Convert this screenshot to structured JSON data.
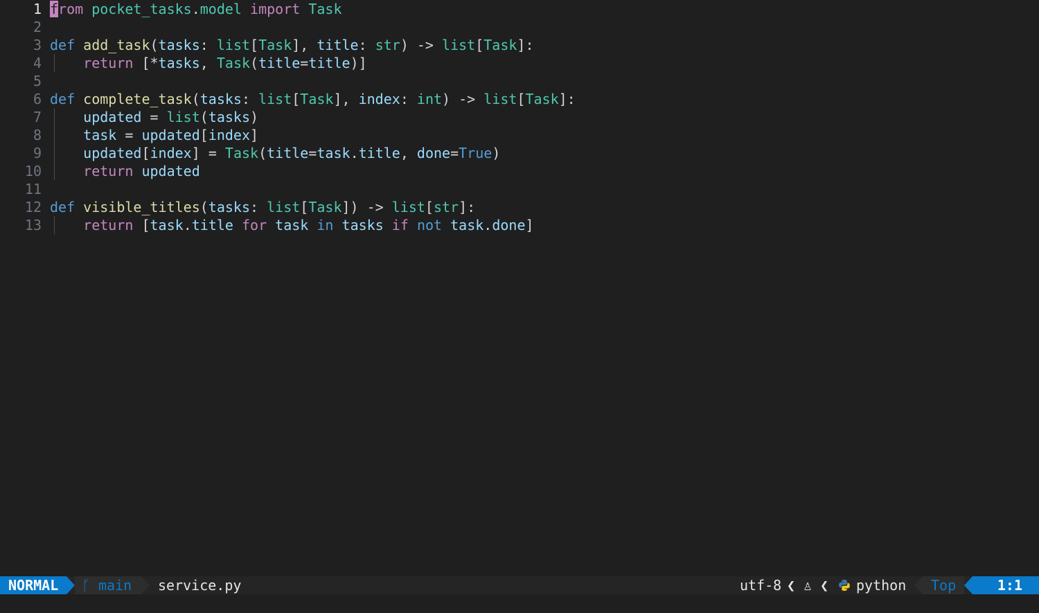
{
  "editor": {
    "lines": [
      {
        "n": "1",
        "tokens": [
          {
            "t": "f",
            "c": "cursor"
          },
          {
            "t": "rom",
            "c": "keyword"
          },
          {
            "t": " ",
            "c": "punct"
          },
          {
            "t": "pocket_tasks",
            "c": "module"
          },
          {
            "t": ".",
            "c": "punct"
          },
          {
            "t": "model",
            "c": "module"
          },
          {
            "t": " ",
            "c": "punct"
          },
          {
            "t": "import",
            "c": "keyword"
          },
          {
            "t": " ",
            "c": "punct"
          },
          {
            "t": "Task",
            "c": "type"
          }
        ]
      },
      {
        "n": "2",
        "tokens": []
      },
      {
        "n": "3",
        "tokens": [
          {
            "t": "def",
            "c": "def"
          },
          {
            "t": " ",
            "c": "punct"
          },
          {
            "t": "add_task",
            "c": "funcname"
          },
          {
            "t": "(",
            "c": "punct"
          },
          {
            "t": "tasks",
            "c": "param"
          },
          {
            "t": ": ",
            "c": "punct"
          },
          {
            "t": "list",
            "c": "type"
          },
          {
            "t": "[",
            "c": "punct"
          },
          {
            "t": "Task",
            "c": "type"
          },
          {
            "t": "], ",
            "c": "punct"
          },
          {
            "t": "title",
            "c": "param"
          },
          {
            "t": ": ",
            "c": "punct"
          },
          {
            "t": "str",
            "c": "type"
          },
          {
            "t": ") -> ",
            "c": "punct"
          },
          {
            "t": "list",
            "c": "type"
          },
          {
            "t": "[",
            "c": "punct"
          },
          {
            "t": "Task",
            "c": "type"
          },
          {
            "t": "]:",
            "c": "punct"
          }
        ]
      },
      {
        "n": "4",
        "guide": true,
        "tokens": [
          {
            "t": "    ",
            "c": "punct"
          },
          {
            "t": "return",
            "c": "keyword"
          },
          {
            "t": " [*",
            "c": "punct"
          },
          {
            "t": "tasks",
            "c": "param"
          },
          {
            "t": ", ",
            "c": "punct"
          },
          {
            "t": "Task",
            "c": "type"
          },
          {
            "t": "(",
            "c": "punct"
          },
          {
            "t": "title",
            "c": "param"
          },
          {
            "t": "=",
            "c": "punct"
          },
          {
            "t": "title",
            "c": "param"
          },
          {
            "t": ")]",
            "c": "punct"
          }
        ]
      },
      {
        "n": "5",
        "tokens": []
      },
      {
        "n": "6",
        "tokens": [
          {
            "t": "def",
            "c": "def"
          },
          {
            "t": " ",
            "c": "punct"
          },
          {
            "t": "complete_task",
            "c": "funcname"
          },
          {
            "t": "(",
            "c": "punct"
          },
          {
            "t": "tasks",
            "c": "param"
          },
          {
            "t": ": ",
            "c": "punct"
          },
          {
            "t": "list",
            "c": "type"
          },
          {
            "t": "[",
            "c": "punct"
          },
          {
            "t": "Task",
            "c": "type"
          },
          {
            "t": "], ",
            "c": "punct"
          },
          {
            "t": "index",
            "c": "param"
          },
          {
            "t": ": ",
            "c": "punct"
          },
          {
            "t": "int",
            "c": "type"
          },
          {
            "t": ") -> ",
            "c": "punct"
          },
          {
            "t": "list",
            "c": "type"
          },
          {
            "t": "[",
            "c": "punct"
          },
          {
            "t": "Task",
            "c": "type"
          },
          {
            "t": "]:",
            "c": "punct"
          }
        ]
      },
      {
        "n": "7",
        "guide": true,
        "tokens": [
          {
            "t": "    ",
            "c": "punct"
          },
          {
            "t": "updated",
            "c": "param"
          },
          {
            "t": " = ",
            "c": "punct"
          },
          {
            "t": "list",
            "c": "type"
          },
          {
            "t": "(",
            "c": "punct"
          },
          {
            "t": "tasks",
            "c": "param"
          },
          {
            "t": ")",
            "c": "punct"
          }
        ]
      },
      {
        "n": "8",
        "guide": true,
        "tokens": [
          {
            "t": "    ",
            "c": "punct"
          },
          {
            "t": "task",
            "c": "param"
          },
          {
            "t": " = ",
            "c": "punct"
          },
          {
            "t": "updated",
            "c": "param"
          },
          {
            "t": "[",
            "c": "punct"
          },
          {
            "t": "index",
            "c": "param"
          },
          {
            "t": "]",
            "c": "punct"
          }
        ]
      },
      {
        "n": "9",
        "guide": true,
        "tokens": [
          {
            "t": "    ",
            "c": "punct"
          },
          {
            "t": "updated",
            "c": "param"
          },
          {
            "t": "[",
            "c": "punct"
          },
          {
            "t": "index",
            "c": "param"
          },
          {
            "t": "] = ",
            "c": "punct"
          },
          {
            "t": "Task",
            "c": "type"
          },
          {
            "t": "(",
            "c": "punct"
          },
          {
            "t": "title",
            "c": "param"
          },
          {
            "t": "=",
            "c": "punct"
          },
          {
            "t": "task",
            "c": "param"
          },
          {
            "t": ".",
            "c": "punct"
          },
          {
            "t": "title",
            "c": "param"
          },
          {
            "t": ", ",
            "c": "punct"
          },
          {
            "t": "done",
            "c": "param"
          },
          {
            "t": "=",
            "c": "punct"
          },
          {
            "t": "True",
            "c": "const"
          },
          {
            "t": ")",
            "c": "punct"
          }
        ]
      },
      {
        "n": "10",
        "guide": true,
        "tokens": [
          {
            "t": "    ",
            "c": "punct"
          },
          {
            "t": "return",
            "c": "keyword"
          },
          {
            "t": " ",
            "c": "punct"
          },
          {
            "t": "updated",
            "c": "param"
          }
        ]
      },
      {
        "n": "11",
        "tokens": []
      },
      {
        "n": "12",
        "tokens": [
          {
            "t": "def",
            "c": "def"
          },
          {
            "t": " ",
            "c": "punct"
          },
          {
            "t": "visible_titles",
            "c": "funcname"
          },
          {
            "t": "(",
            "c": "punct"
          },
          {
            "t": "tasks",
            "c": "param"
          },
          {
            "t": ": ",
            "c": "punct"
          },
          {
            "t": "list",
            "c": "type"
          },
          {
            "t": "[",
            "c": "punct"
          },
          {
            "t": "Task",
            "c": "type"
          },
          {
            "t": "]) -> ",
            "c": "punct"
          },
          {
            "t": "list",
            "c": "type"
          },
          {
            "t": "[",
            "c": "punct"
          },
          {
            "t": "str",
            "c": "type"
          },
          {
            "t": "]:",
            "c": "punct"
          }
        ]
      },
      {
        "n": "13",
        "guide": true,
        "tokens": [
          {
            "t": "    ",
            "c": "punct"
          },
          {
            "t": "return",
            "c": "keyword"
          },
          {
            "t": " [",
            "c": "punct"
          },
          {
            "t": "task",
            "c": "param"
          },
          {
            "t": ".",
            "c": "punct"
          },
          {
            "t": "title",
            "c": "param"
          },
          {
            "t": " ",
            "c": "punct"
          },
          {
            "t": "for",
            "c": "keyword"
          },
          {
            "t": " ",
            "c": "punct"
          },
          {
            "t": "task",
            "c": "param"
          },
          {
            "t": " ",
            "c": "punct"
          },
          {
            "t": "in",
            "c": "def"
          },
          {
            "t": " ",
            "c": "punct"
          },
          {
            "t": "tasks",
            "c": "param"
          },
          {
            "t": " ",
            "c": "punct"
          },
          {
            "t": "if",
            "c": "keyword"
          },
          {
            "t": " ",
            "c": "punct"
          },
          {
            "t": "not",
            "c": "def"
          },
          {
            "t": " ",
            "c": "punct"
          },
          {
            "t": "task",
            "c": "param"
          },
          {
            "t": ".",
            "c": "punct"
          },
          {
            "t": "done",
            "c": "param"
          },
          {
            "t": "]",
            "c": "punct"
          }
        ]
      }
    ]
  },
  "statusline": {
    "mode": "NORMAL",
    "branch_icon": "git-branch-icon",
    "branch": "main",
    "filename": "service.py",
    "encoding": "utf-8",
    "separator": "❮",
    "os_icon": "linux-tux-icon",
    "os_glyph": "♙",
    "filetype_icon": "python-icon",
    "filetype": "python",
    "percent": "Top",
    "location": "1:1"
  },
  "colors": {
    "accent": "#0a7aca",
    "background": "#1f1f1f",
    "cursor": "#c586c0"
  }
}
